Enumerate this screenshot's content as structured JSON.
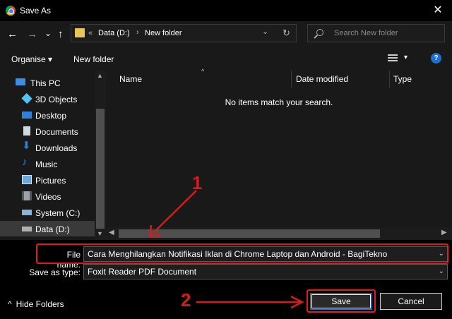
{
  "window": {
    "title": "Save As",
    "close": "✕"
  },
  "nav": {
    "back": "←",
    "forward": "→",
    "recent": "⌄",
    "up": "↑",
    "address": {
      "sep": "«",
      "segments": [
        "Data (D:)",
        "New folder"
      ],
      "chev": "›",
      "dropdown": "⌄",
      "refresh": "↻"
    },
    "search_placeholder": "Search New folder"
  },
  "toolbar": {
    "organise": "Organise ▾",
    "new_folder": "New folder",
    "view_caret": "▾",
    "help": "?"
  },
  "sidebar": {
    "items": [
      {
        "label": "This PC",
        "icon": "pc-icon",
        "color": "#3a8ee6"
      },
      {
        "label": "3D Objects",
        "icon": "cube-icon",
        "color": "#4fc3f7"
      },
      {
        "label": "Desktop",
        "icon": "desktop-icon",
        "color": "#2f80d8"
      },
      {
        "label": "Documents",
        "icon": "document-icon",
        "color": "#cfd8dc"
      },
      {
        "label": "Downloads",
        "icon": "download-icon",
        "color": "#2f80d8"
      },
      {
        "label": "Music",
        "icon": "music-icon",
        "color": "#2f80d8"
      },
      {
        "label": "Pictures",
        "icon": "pictures-icon",
        "color": "#6aa8e0"
      },
      {
        "label": "Videos",
        "icon": "videos-icon",
        "color": "#9aa3ab"
      },
      {
        "label": "System (C:)",
        "icon": "drive-icon",
        "color": "#8ab4d8"
      },
      {
        "label": "Data (D:)",
        "icon": "drive-icon",
        "color": "#b0b0b0"
      }
    ]
  },
  "columns": {
    "name": "Name",
    "date": "Date modified",
    "type": "Type",
    "sort": "^"
  },
  "empty_message": "No items match your search.",
  "form": {
    "file_name_label": "File name:",
    "file_name_value": "Cara Menghilangkan Notifikasi Iklan di Chrome Laptop dan Android - BagiTekno",
    "save_type_label": "Save as type:",
    "save_type_value": "Foxit Reader PDF Document",
    "dropdown": "⌄"
  },
  "buttons": {
    "save": "Save",
    "cancel": "Cancel",
    "hide_folders": "Hide Folders",
    "hide_chev": "^"
  },
  "annotations": {
    "one": "1",
    "two": "2",
    "color": "#d41c1c"
  }
}
